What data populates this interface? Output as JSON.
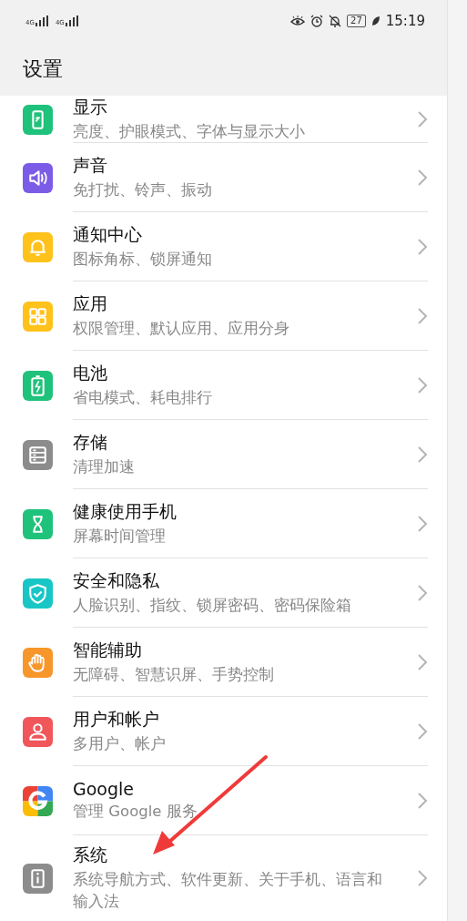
{
  "status_bar": {
    "signals": [
      {
        "label": "4G"
      },
      {
        "label": "4G"
      }
    ],
    "battery": "27",
    "time": "15:19"
  },
  "header": {
    "title": "设置"
  },
  "items": [
    {
      "title": "显示",
      "subtitle": "亮度、护眼模式、字体与显示大小",
      "kind": "display",
      "color": "#1fc27a"
    },
    {
      "title": "声音",
      "subtitle": "免打扰、铃声、振动",
      "kind": "sound",
      "color": "#7b5ce6"
    },
    {
      "title": "通知中心",
      "subtitle": "图标角标、锁屏通知",
      "kind": "bell",
      "color": "#ffc21a"
    },
    {
      "title": "应用",
      "subtitle": "权限管理、默认应用、应用分身",
      "kind": "apps",
      "color": "#ffc21a"
    },
    {
      "title": "电池",
      "subtitle": "省电模式、耗电排行",
      "kind": "battery",
      "color": "#1fc27a"
    },
    {
      "title": "存储",
      "subtitle": "清理加速",
      "kind": "storage",
      "color": "#8c8c8c"
    },
    {
      "title": "健康使用手机",
      "subtitle": "屏幕时间管理",
      "kind": "hourglass",
      "color": "#1fc27a"
    },
    {
      "title": "安全和隐私",
      "subtitle": "人脸识别、指纹、锁屏密码、密码保险箱",
      "kind": "shield",
      "color": "#19c6c6"
    },
    {
      "title": "智能辅助",
      "subtitle": "无障碍、智慧识屏、手势控制",
      "kind": "hand",
      "color": "#f7962a"
    },
    {
      "title": "用户和帐户",
      "subtitle": "多用户、帐户",
      "kind": "user",
      "color": "#f0565a"
    },
    {
      "title": "Google",
      "subtitle": "管理 Google 服务",
      "kind": "google",
      "color": "#4285f4"
    },
    {
      "title": "系统",
      "subtitle": "系统导航方式、软件更新、关于手机、语言和输入法",
      "kind": "info",
      "color": "#8c8c8c"
    }
  ],
  "annotation": {
    "kind": "arrow"
  }
}
